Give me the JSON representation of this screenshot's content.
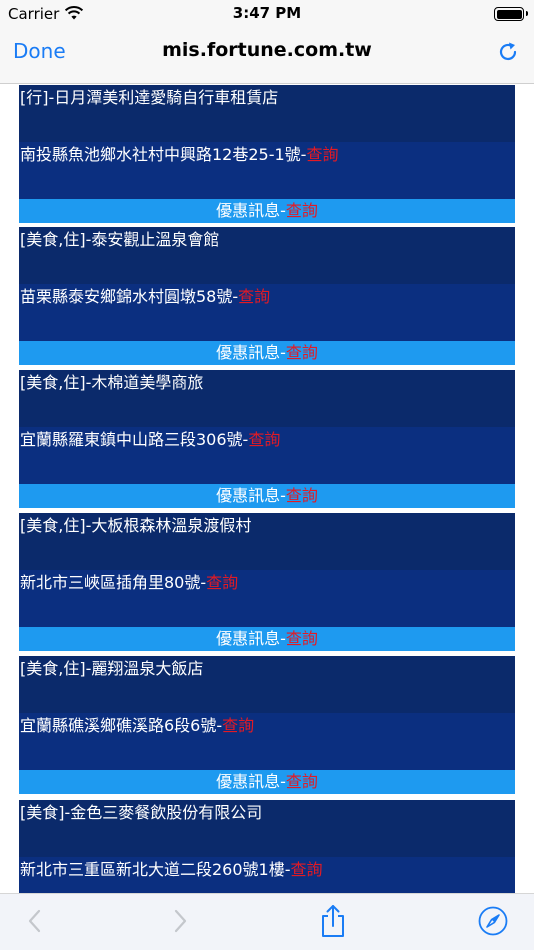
{
  "status": {
    "carrier": "Carrier",
    "time": "3:47 PM"
  },
  "nav": {
    "done_label": "Done",
    "url": "mis.fortune.com.tw"
  },
  "listings": [
    {
      "name": "[行]-日月潭美利達愛騎自行車租賃店",
      "address": "南投縣魚池鄉水社村中興路12巷25-1號-",
      "query": "查詢",
      "promo": "優惠訊息-",
      "promo_query": "查詢"
    },
    {
      "name": "[美食,住]-泰安觀止溫泉會館",
      "address": "苗栗縣泰安鄉錦水村圓墩58號-",
      "query": "查詢",
      "promo": "優惠訊息-",
      "promo_query": "查詢"
    },
    {
      "name": "[美食,住]-木棉道美學商旅",
      "address": "宜蘭縣羅東鎮中山路三段306號-",
      "query": "查詢",
      "promo": "優惠訊息-",
      "promo_query": "查詢"
    },
    {
      "name": "[美食,住]-大板根森林溫泉渡假村",
      "address": "新北市三峽區插角里80號-",
      "query": "查詢",
      "promo": "優惠訊息-",
      "promo_query": "查詢"
    },
    {
      "name": "[美食,住]-麗翔溫泉大飯店",
      "address": "宜蘭縣礁溪鄉礁溪路6段6號-",
      "query": "查詢",
      "promo": "優惠訊息-",
      "promo_query": "查詢"
    },
    {
      "name": "[美食]-金色三麥餐飲股份有限公司",
      "address": "新北市三重區新北大道二段260號1樓-",
      "query": "查詢"
    }
  ],
  "toolbar": {
    "back_icon": "chevron-left-icon",
    "forward_icon": "chevron-right-icon",
    "share_icon": "share-icon",
    "safari_icon": "compass-icon"
  }
}
